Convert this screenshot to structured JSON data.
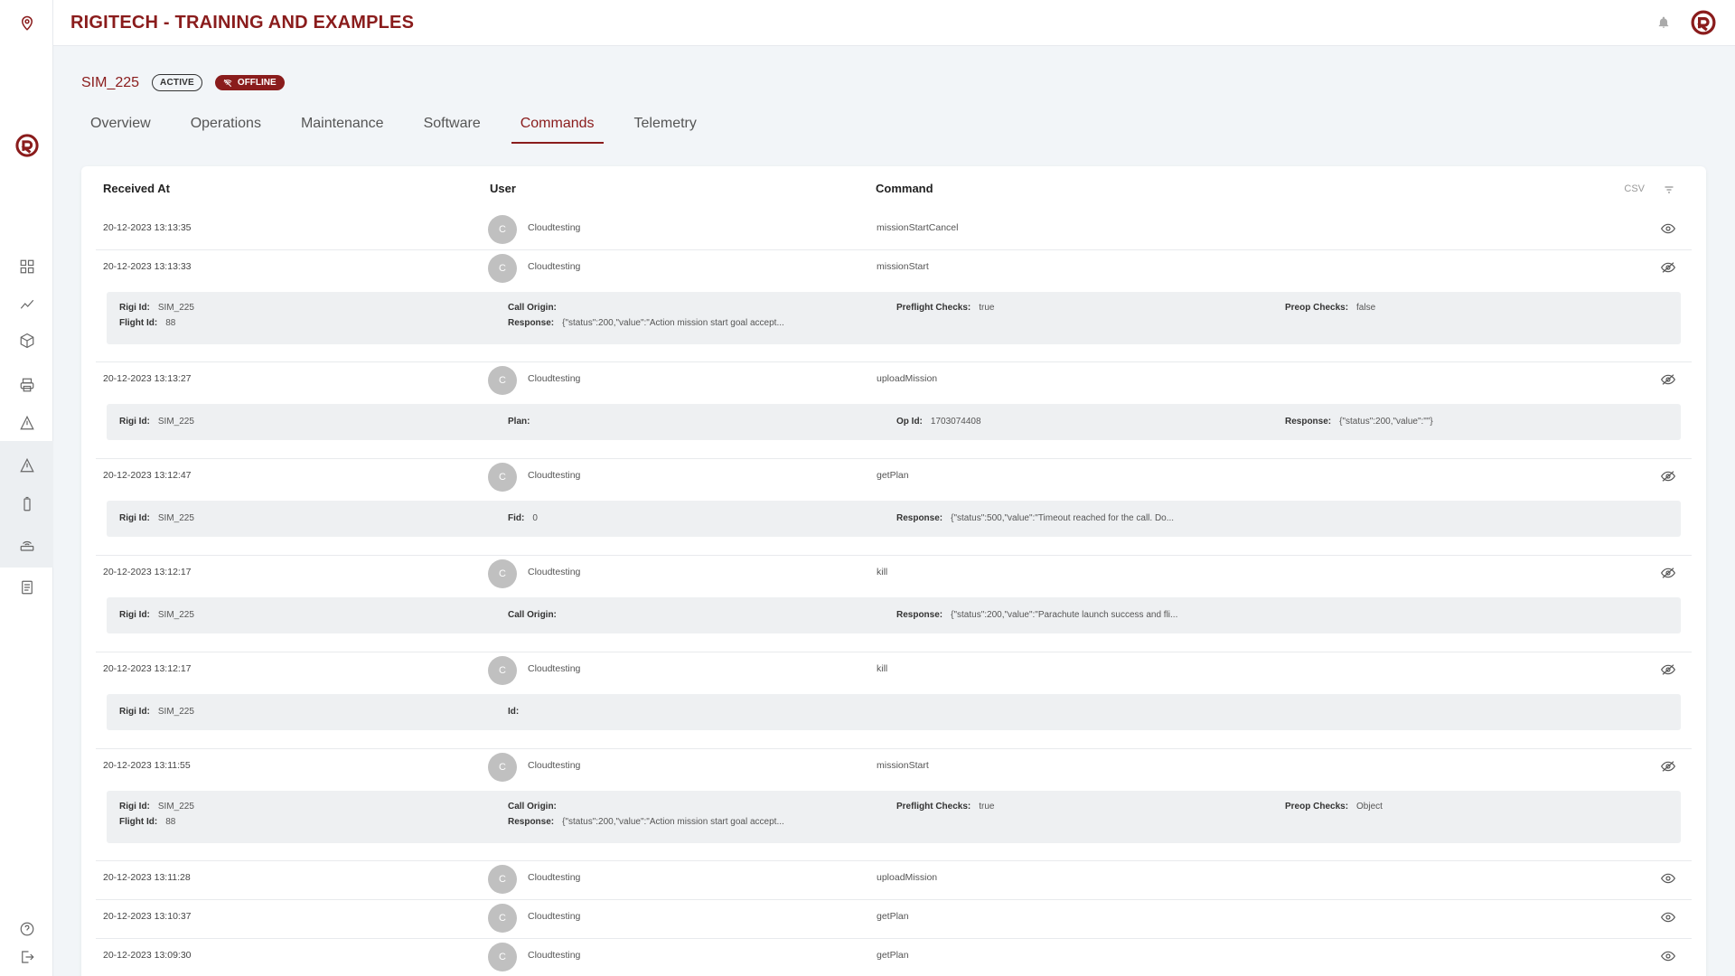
{
  "app": {
    "title": "RIGITECH - TRAINING AND EXAMPLES"
  },
  "device": {
    "name": "SIM_225",
    "status_active": "ACTIVE",
    "status_offline": "OFFLINE"
  },
  "tabs": [
    "Overview",
    "Operations",
    "Maintenance",
    "Software",
    "Commands",
    "Telemetry"
  ],
  "active_tab": "Commands",
  "table": {
    "headers": {
      "received_at": "Received At",
      "user": "User",
      "command": "Command"
    },
    "csv_label": "CSV",
    "rows": [
      {
        "date": "20-12-2023 13:13:35",
        "avatar": "C",
        "user": "Cloudtesting",
        "command": "missionStartCancel",
        "expanded": false
      },
      {
        "date": "20-12-2023 13:13:33",
        "avatar": "C",
        "user": "Cloudtesting",
        "command": "missionStart",
        "expanded": true,
        "details": [
          {
            "label": "Rigi Id:",
            "value": "SIM_225"
          },
          {
            "label": "Call Origin:",
            "value": ""
          },
          {
            "label": "Preflight Checks:",
            "value": "true"
          },
          {
            "label": "Preop Checks:",
            "value": "false"
          },
          {
            "label": "Flight Id:",
            "value": "88"
          },
          {
            "label": "Response:",
            "value": "{\"status\":200,\"value\":\"Action mission start goal accept..."
          }
        ]
      },
      {
        "date": "20-12-2023 13:13:27",
        "avatar": "C",
        "user": "Cloudtesting",
        "command": "uploadMission",
        "expanded": true,
        "details": [
          {
            "label": "Rigi Id:",
            "value": "SIM_225"
          },
          {
            "label": "Plan:",
            "value": ""
          },
          {
            "label": "Op Id:",
            "value": "1703074408"
          },
          {
            "label": "Response:",
            "value": "{\"status\":200,\"value\":\"\"}"
          }
        ]
      },
      {
        "date": "20-12-2023 13:12:47",
        "avatar": "C",
        "user": "Cloudtesting",
        "command": "getPlan",
        "expanded": true,
        "details": [
          {
            "label": "Rigi Id:",
            "value": "SIM_225"
          },
          {
            "label": "Fid:",
            "value": "0"
          },
          {
            "label": "Response:",
            "value": "{\"status\":500,\"value\":\"Timeout reached for the call. Do..."
          }
        ]
      },
      {
        "date": "20-12-2023 13:12:17",
        "avatar": "C",
        "user": "Cloudtesting",
        "command": "kill",
        "expanded": true,
        "details": [
          {
            "label": "Rigi Id:",
            "value": "SIM_225"
          },
          {
            "label": "Call Origin:",
            "value": ""
          },
          {
            "label": "Response:",
            "value": "{\"status\":200,\"value\":\"Parachute launch success and fli..."
          }
        ]
      },
      {
        "date": "20-12-2023 13:12:17",
        "avatar": "C",
        "user": "Cloudtesting",
        "command": "kill",
        "expanded": true,
        "details": [
          {
            "label": "Rigi Id:",
            "value": "SIM_225"
          },
          {
            "label": "Id:",
            "value": ""
          }
        ]
      },
      {
        "date": "20-12-2023 13:11:55",
        "avatar": "C",
        "user": "Cloudtesting",
        "command": "missionStart",
        "expanded": true,
        "details": [
          {
            "label": "Rigi Id:",
            "value": "SIM_225"
          },
          {
            "label": "Call Origin:",
            "value": ""
          },
          {
            "label": "Preflight Checks:",
            "value": "true"
          },
          {
            "label": "Preop Checks:",
            "value": "Object"
          },
          {
            "label": "Flight Id:",
            "value": "88"
          },
          {
            "label": "Response:",
            "value": "{\"status\":200,\"value\":\"Action mission start goal accept..."
          }
        ]
      },
      {
        "date": "20-12-2023 13:11:28",
        "avatar": "C",
        "user": "Cloudtesting",
        "command": "uploadMission",
        "expanded": false
      },
      {
        "date": "20-12-2023 13:10:37",
        "avatar": "C",
        "user": "Cloudtesting",
        "command": "getPlan",
        "expanded": false
      },
      {
        "date": "20-12-2023 13:09:30",
        "avatar": "C",
        "user": "Cloudtesting",
        "command": "getPlan",
        "expanded": false
      }
    ]
  },
  "sidebar": {
    "icons": [
      "location-pin-icon",
      "brand-logo-icon",
      "dashboard-icon",
      "chart-icon",
      "box-icon",
      "printer-icon",
      "warning-icon",
      "alert-icon",
      "battery-icon",
      "router-icon",
      "document-icon",
      "help-icon",
      "logout-icon"
    ]
  },
  "colors": {
    "brand": "#8a1c1c",
    "background": "#f2f5f8",
    "detail_bg": "#eef0f2"
  }
}
